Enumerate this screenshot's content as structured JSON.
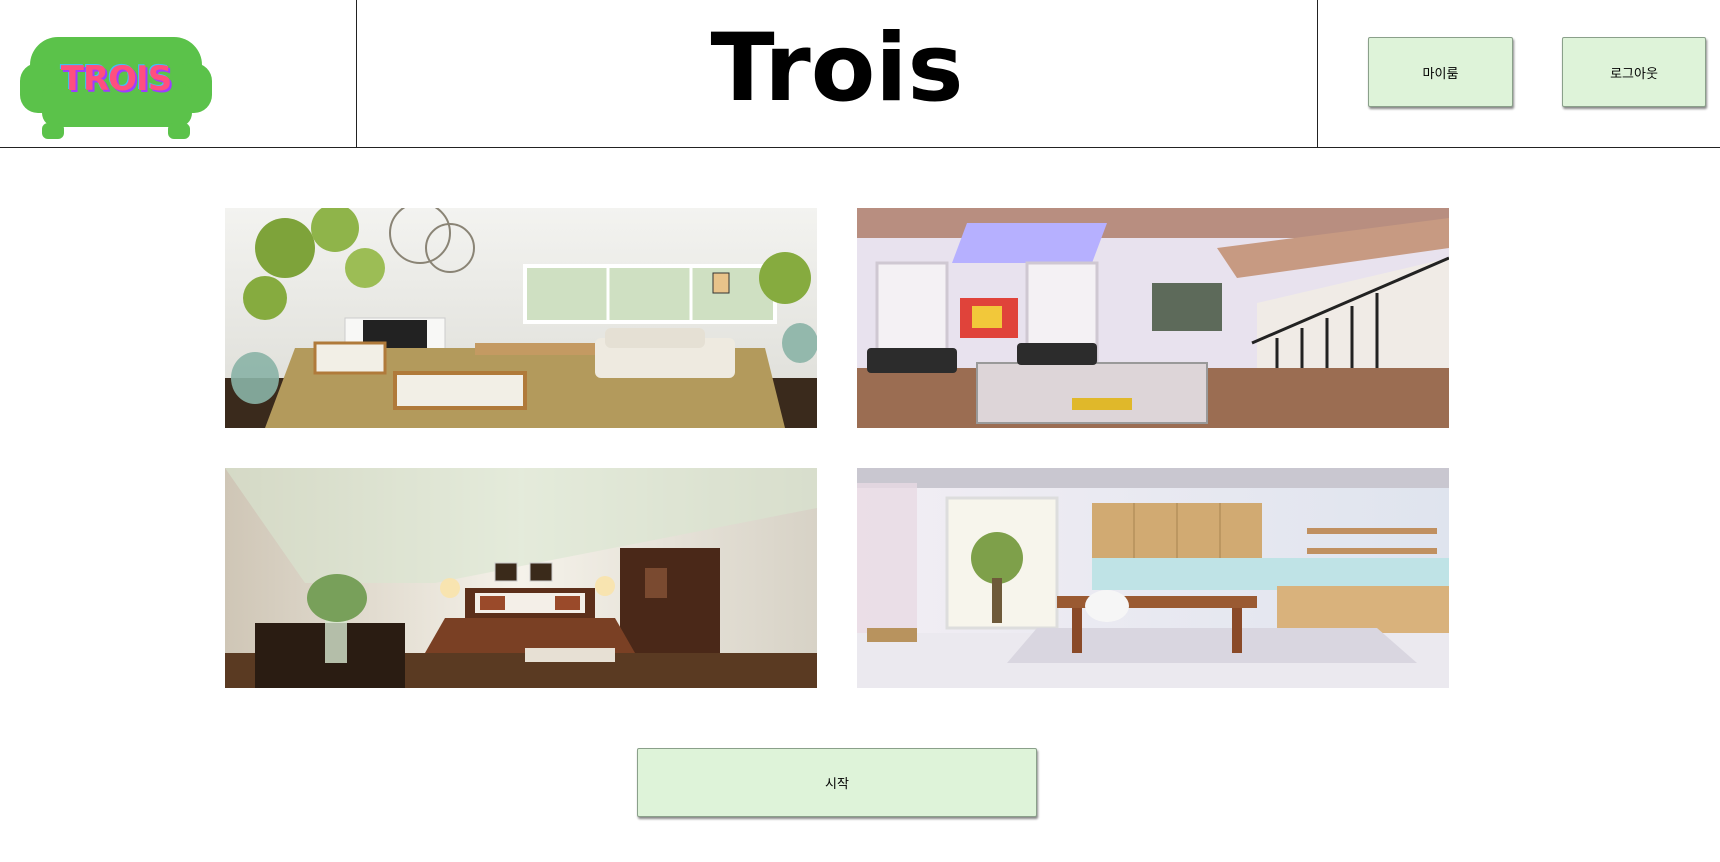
{
  "header": {
    "logo_text": "TROIS",
    "title": "Trois",
    "myroom_label": "마이룸",
    "logout_label": "로그아웃"
  },
  "gallery": [
    {
      "name": "living-room-photo"
    },
    {
      "name": "loft-staircase-photo"
    },
    {
      "name": "bedroom-photo"
    },
    {
      "name": "kitchen-photo"
    }
  ],
  "actions": {
    "start_label": "시작"
  },
  "colors": {
    "button_bg": "#def3d9",
    "logo_sofa": "#5bc24a"
  }
}
